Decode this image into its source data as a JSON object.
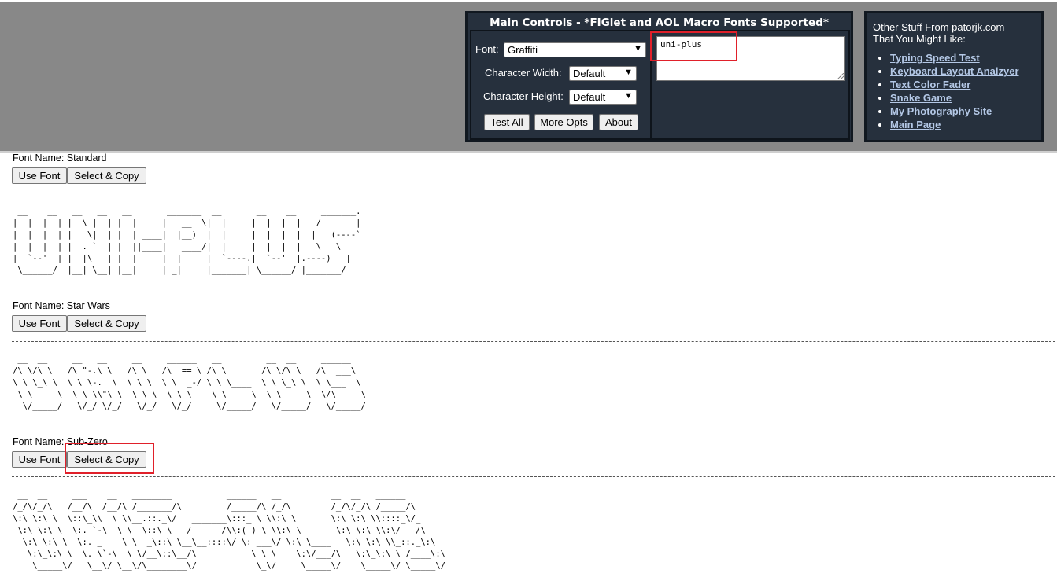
{
  "main_controls": {
    "title": "Main Controls - *FIGlet and AOL Macro Fonts Supported*",
    "font_label": "Font:",
    "font_value": "Graffiti",
    "char_width_label": "Character Width:",
    "char_width_value": "Default",
    "char_height_label": "Character Height:",
    "char_height_value": "Default",
    "buttons": {
      "test_all": "Test All",
      "more_opts": "More Opts",
      "about": "About"
    },
    "input_text": "uni-plus"
  },
  "other_stuff": {
    "heading_line1": "Other Stuff From patorjk.com",
    "heading_line2": "That You Might Like:",
    "links": [
      "Typing Speed Test",
      "Keyboard Layout Analzyer",
      "Text Color Fader",
      "Snake Game",
      "My Photography Site",
      "Main Page"
    ]
  },
  "fonts": [
    {
      "name_line": "Font Name: Standard",
      "use_font": "Use Font",
      "select_copy": "Select & Copy",
      "art": " __    __   __   __   __       _______  __       __    __     _______. \n|  |  |  | |  \\ |  | |  |     |   __  \\|  |     |  |  |  |   /       | \n|  |  |  | |   \\|  | |  | ____|  |__)  |  |     |  |  |  |  |   (----` \n|  |  |  | |  . `  | |  ||____|   ____/|  |     |  |  |  |   \\   \\     \n|  `--'  | |  |\\   | |  |     |  |     |  `----.|  `--'  |.----)   |    \n \\______/  |__| \\__| |__|     | _|     |_______| \\______/ |_______/     "
    },
    {
      "name_line": "Font Name: Star Wars",
      "use_font": "Use Font",
      "select_copy": "Select & Copy",
      "art": " __  __     __   __     __     ______   __         __  __     ______    \n/\\ \\/\\ \\   /\\ \"-.\\ \\   /\\ \\   /\\  == \\ /\\ \\       /\\ \\/\\ \\   /\\  ___\\   \n\\ \\ \\_\\ \\  \\ \\ \\-.  \\  \\ \\ \\  \\ \\  _-/ \\ \\ \\____  \\ \\ \\_\\ \\  \\ \\___  \\  \n \\ \\_____\\  \\ \\_\\\\\"\\_\\  \\ \\_\\  \\ \\_\\    \\ \\_____\\  \\ \\_____\\  \\/\\_____\\ \n  \\/_____/   \\/_/ \\/_/   \\/_/   \\/_/     \\/_____/   \\/_____/   \\/_____/ "
    },
    {
      "name_line": "Font Name: Sub-Zero",
      "use_font": "Use Font",
      "select_copy": "Select & Copy",
      "art": " __  __     ___    __   ________           ______   __          __  __   ______    \n/_/\\/_/\\   /__/\\  /__/\\ /_______/\\         /_____/\\ /_/\\        /_/\\/_/\\ /_____/\\   \n\\:\\ \\:\\ \\  \\::\\_\\\\  \\ \\\\__.::._\\/   _______\\:::_ \\ \\\\:\\ \\       \\:\\ \\:\\ \\\\::::_\\/_  \n \\:\\ \\:\\ \\  \\:. `-\\  \\ \\  \\::\\ \\   /______/\\\\:(_) \\ \\\\:\\ \\       \\:\\ \\:\\ \\\\:\\/___/\\ \n  \\:\\ \\:\\ \\  \\:. _    \\ \\  _\\::\\ \\__\\__::::\\/ \\: ___\\/ \\:\\ \\____   \\:\\ \\:\\ \\\\_::._\\:\\\n   \\:\\_\\:\\ \\  \\. \\`-\\  \\ \\/__\\::\\__/\\           \\ \\ \\    \\:\\/___/\\   \\:\\_\\:\\ \\ /____\\:\\\n    \\_____\\/   \\__\\/ \\__\\/\\________\\/            \\_\\/     \\_____\\/    \\_____\\/ \\_____\\/"
    }
  ]
}
